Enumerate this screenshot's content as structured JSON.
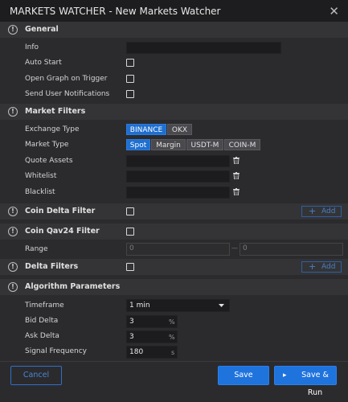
{
  "window": {
    "title": "MARKETS WATCHER - New Markets Watcher",
    "close_glyph": "✕"
  },
  "sections": {
    "general": "General",
    "market_filters": "Market Filters",
    "coin_delta": "Coin Delta Filter",
    "coin_qav": "Coin Qav24 Filter",
    "delta_filters": "Delta Filters",
    "algorithm": "Algorithm Parameters"
  },
  "general": {
    "info_label": "Info",
    "info_value": "",
    "auto_start_label": "Auto Start",
    "open_graph_label": "Open Graph on Trigger",
    "notifications_label": "Send User Notifications"
  },
  "market": {
    "exchange_label": "Exchange Type",
    "exchanges": [
      "BINANCE",
      "OKX"
    ],
    "exchange_selected": "BINANCE",
    "market_label": "Market Type",
    "market_types": [
      "Spot",
      "Margin",
      "USDT-M",
      "COIN-M"
    ],
    "market_selected": "Spot",
    "quote_label": "Quote Assets",
    "whitelist_label": "Whitelist",
    "blacklist_label": "Blacklist"
  },
  "coin_qav": {
    "range_label": "Range",
    "range_min_placeholder": "0",
    "range_separator": "—",
    "range_max_placeholder": "0"
  },
  "add_button": {
    "plus": "+",
    "label": "Add"
  },
  "algorithm": {
    "timeframe_label": "Timeframe",
    "timeframe_value": "1 min",
    "bid_label": "Bid Delta",
    "bid_value": "3",
    "ask_label": "Ask Delta",
    "ask_value": "3",
    "percent_unit": "%",
    "signal_label": "Signal Frequency",
    "signal_value": "180",
    "signal_unit": "s"
  },
  "footer": {
    "cancel": "Cancel",
    "save": "Save",
    "save_run": "Save & Run",
    "run_glyph": "▸"
  },
  "icons": {
    "info": "!",
    "trash": "trash-icon",
    "dropdown": "chevron-down-icon"
  },
  "colors": {
    "accent": "#1f73dd",
    "background": "#2b2b2e",
    "section": "#343437",
    "input": "#1c1c1f"
  }
}
